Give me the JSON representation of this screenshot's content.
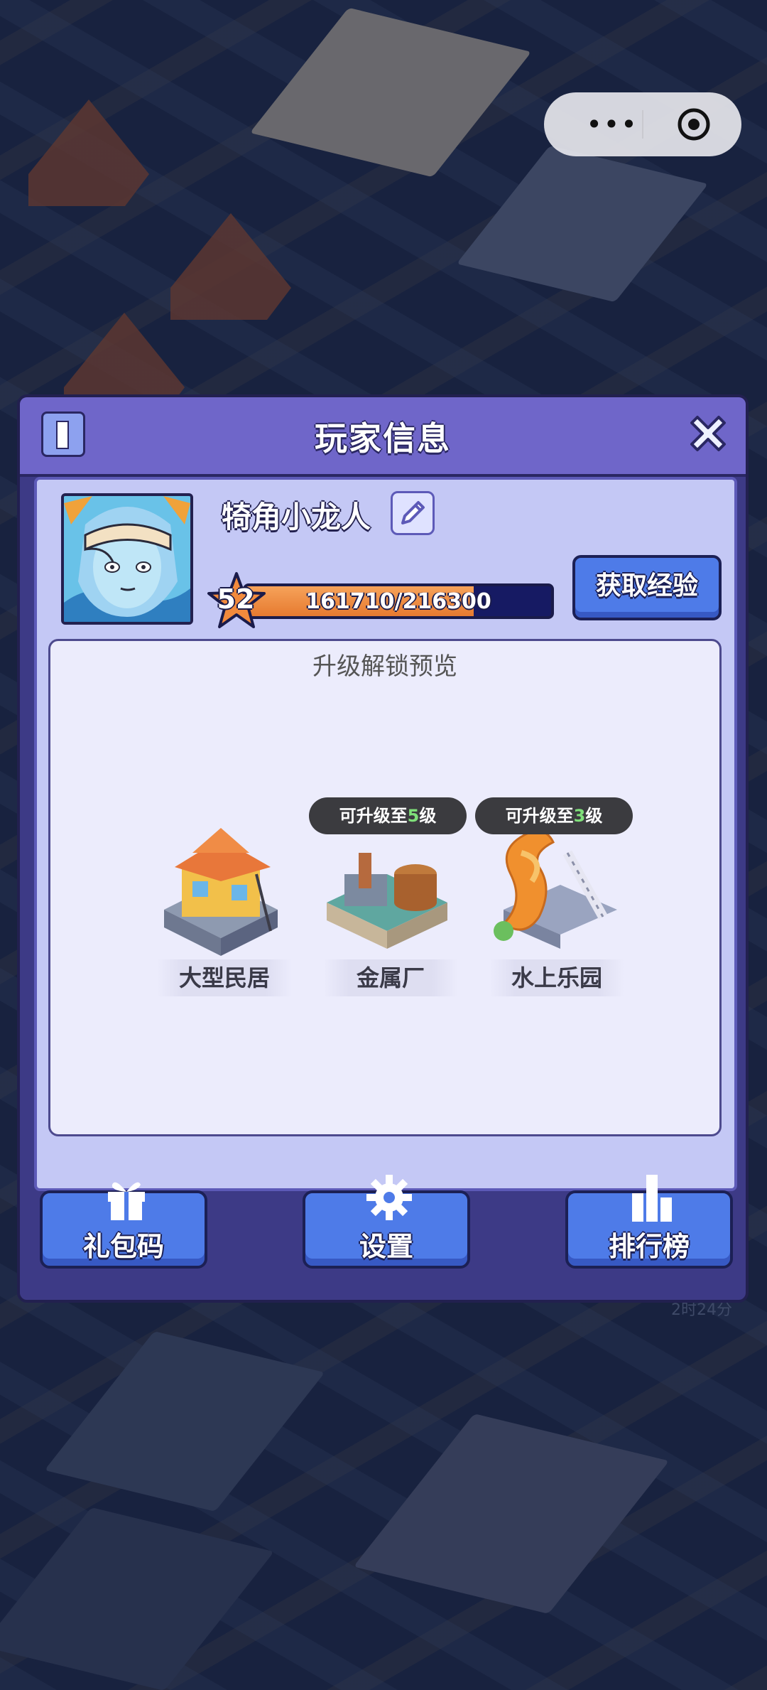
{
  "background": {
    "timer_text": "2时24分"
  },
  "capsule": {
    "more_icon": "more-dots-icon",
    "close_icon": "target-icon"
  },
  "dialog": {
    "title": "玩家信息",
    "info_icon": "info-icon",
    "close_icon": "close-icon",
    "player": {
      "name": "犄角小龙人",
      "level": "52",
      "xp_text": "161710/216300",
      "xp_current": 161710,
      "xp_total": 216300,
      "edit_icon": "pencil-icon"
    },
    "get_exp_label": "获取经验",
    "preview": {
      "title": "升级解锁预览",
      "buildings": [
        {
          "name": "大型民居",
          "upgrade": null
        },
        {
          "name": "金属厂",
          "upgrade": {
            "prefix": "可升级至",
            "level": "5",
            "suffix": "级"
          }
        },
        {
          "name": "水上乐园",
          "upgrade": {
            "prefix": "可升级至",
            "level": "3",
            "suffix": "级"
          }
        }
      ]
    },
    "bottom_buttons": [
      {
        "label": "礼包码",
        "icon": "gift-icon"
      },
      {
        "label": "设置",
        "icon": "gear-icon"
      },
      {
        "label": "排行榜",
        "icon": "bar-chart-icon"
      }
    ]
  }
}
